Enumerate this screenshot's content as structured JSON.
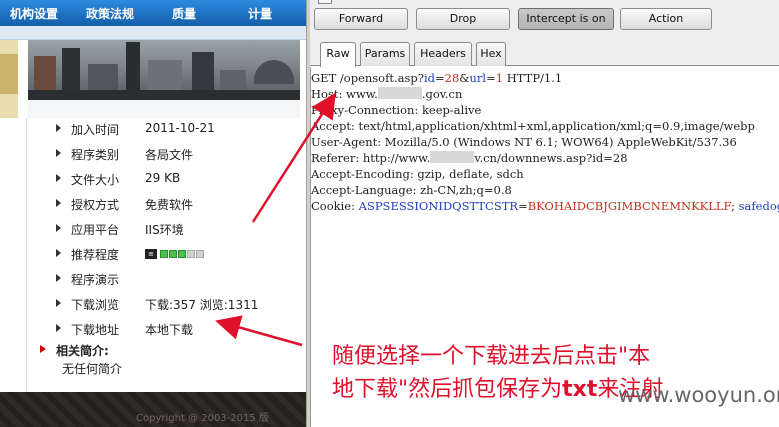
{
  "site": {
    "nav": [
      "机构设置",
      "政策法规",
      "质量",
      "计量"
    ],
    "info": [
      {
        "label": "加入时间",
        "value": "2011-10-21"
      },
      {
        "label": "程序类别",
        "value": "各局文件"
      },
      {
        "label": "文件大小",
        "value": "29 KB"
      },
      {
        "label": "授权方式",
        "value": "免费软件"
      },
      {
        "label": "应用平台",
        "value": "IIS环境"
      },
      {
        "label": "推荐程度",
        "value": "",
        "rating": 3,
        "rating_max": 5
      },
      {
        "label": "程序演示",
        "value": ""
      },
      {
        "label": "下载浏览",
        "value": "下载:357 浏览:1311"
      },
      {
        "label": "下载地址",
        "value": "本地下载"
      }
    ],
    "intro_title": "相关简介:",
    "intro_text": "无任何简介",
    "footer": "Copyright @ 2003-2015   版"
  },
  "burp": {
    "buttons": {
      "forward": "Forward",
      "drop": "Drop",
      "intercept": "Intercept is on",
      "action": "Action"
    },
    "tabs": [
      "Raw",
      "Params",
      "Headers",
      "Hex"
    ],
    "selected_tab": "Raw",
    "request": {
      "l1_pre": "GET /opensoft.asp?",
      "l1_p1": "id",
      "l1_eq1": "=",
      "l1_v1": "28",
      "l1_amp": "&",
      "l1_p2": "url",
      "l1_eq2": "=",
      "l1_v2": "1",
      "l1_post": " HTTP/1.1",
      "host_pre": "Host: www.",
      "host_post": ".gov.cn",
      "l3": "Proxy-Connection: keep-alive",
      "l4": "Accept: text/html,application/xhtml+xml,application/xml;q=0.9,image/webp",
      "l5": "User-Agent: Mozilla/5.0 (Windows NT 6.1; WOW64) AppleWebKit/537.36",
      "ref_pre": "Referer: http://www.",
      "ref_post": "v.cn/downnews.asp?id=28",
      "l7": "Accept-Encoding: gzip, deflate, sdch",
      "l8": "Accept-Language: zh-CN,zh;q=0.8",
      "cookie_pre": "Cookie: ",
      "cookie_name": "ASPSESSIONIDQSTTCSTR",
      "cookie_eq": "=",
      "cookie_val": "BKOHAIDCBJGIMBCNEMNKKLLF",
      "cookie_semi": "; ",
      "cookie_name2": "safedog-flow"
    }
  },
  "annotation": {
    "line1": "随便选择一个下载进去后点击\"本",
    "line2_pre": "地下载\"然后抓包保存为",
    "line2_hl": "txt",
    "line2_post": "来注射"
  },
  "watermark": "www.wooyun.org",
  "colors": {
    "annotation": "#e0102a",
    "nav_bg": "#1a6fc0",
    "param": "#1f3fbf",
    "value": "#c8301f"
  }
}
